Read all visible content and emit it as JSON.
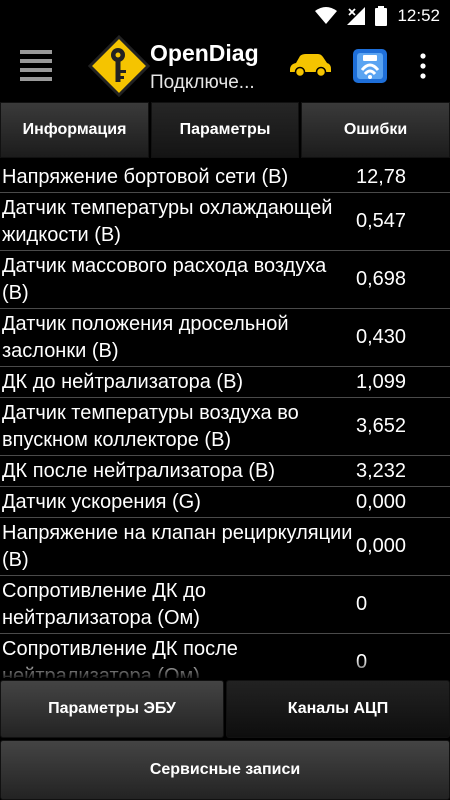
{
  "status_bar": {
    "time": "12:52"
  },
  "app": {
    "title": "OpenDiag",
    "subtitle": "Подключе..."
  },
  "tabs": [
    {
      "label": "Информация"
    },
    {
      "label": "Параметры"
    },
    {
      "label": "Ошибки"
    }
  ],
  "parameters": [
    {
      "name": "Напряжение бортовой сети (В)",
      "value": "12,78"
    },
    {
      "name": "Датчик температуры охлаждающей жидкости (В)",
      "value": "0,547"
    },
    {
      "name": "Датчик массового расхода воздуха (В)",
      "value": "0,698"
    },
    {
      "name": "Датчик положения дросельной заслонки (В)",
      "value": "0,430"
    },
    {
      "name": "ДК до нейтрализатора (В)",
      "value": "1,099"
    },
    {
      "name": "Датчик температуры воздуха во впускном коллекторе (В)",
      "value": "3,652"
    },
    {
      "name": "ДК после нейтрализатора (В)",
      "value": "3,232"
    },
    {
      "name": "Датчик ускорения (G)",
      "value": "0,000"
    },
    {
      "name": "Напряжение на клапан рециркуляции (В)",
      "value": "0,000"
    },
    {
      "name": "Сопротивление ДК до нейтрализатора (Ом)",
      "value": "0"
    },
    {
      "name": "Сопротивление ДК после нейтрализатора (Ом)",
      "value": "0"
    }
  ],
  "bottom": {
    "ecu_params": "Параметры ЭБУ",
    "adc_channels": "Каналы АЦП",
    "service_records": "Сервисные записи"
  }
}
